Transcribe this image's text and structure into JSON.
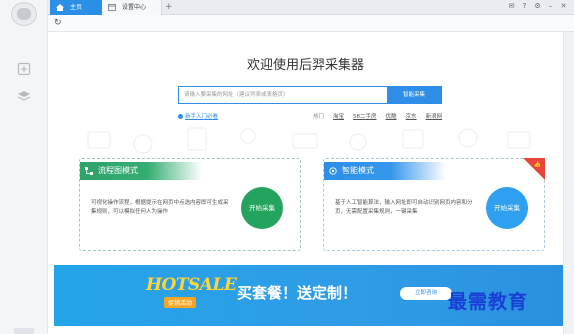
{
  "tabs": [
    {
      "label": "主页",
      "active": true
    },
    {
      "label": "设置中心",
      "active": false
    }
  ],
  "colors": {
    "accent": "#2e8ee8",
    "green": "#23a35e",
    "banner": "#24a4e9",
    "red_corner": "#e8453c"
  },
  "main": {
    "title": "欢迎使用后羿采集器",
    "search": {
      "placeholder": "请输入要采集的网址（建议列表或表格页）",
      "button": "智能采集"
    },
    "beginner_link": "新手入门必看",
    "hot": {
      "label": "热门",
      "links": [
        "淘宝",
        "58二手房",
        "优酷",
        "京东",
        "新浪网"
      ]
    }
  },
  "cards": {
    "flowchart": {
      "title": "流程图模式",
      "description": "可视化操作流程，根据提示在网页中点选内容即可生成采集规则，可以模拟任何人为操作",
      "button": "开始采集"
    },
    "smart": {
      "title": "智能模式",
      "description": "基于人工智能算法，输入网址即可自动识别网页内容和分页，无需配置采集规则，一键采集",
      "button": "开始采集"
    }
  },
  "banner": {
    "logo": "HOTSALE",
    "logo_sub": "促销活动",
    "text": "买套餐！送定制！",
    "button": "立即咨询"
  },
  "watermark": "最需教育"
}
